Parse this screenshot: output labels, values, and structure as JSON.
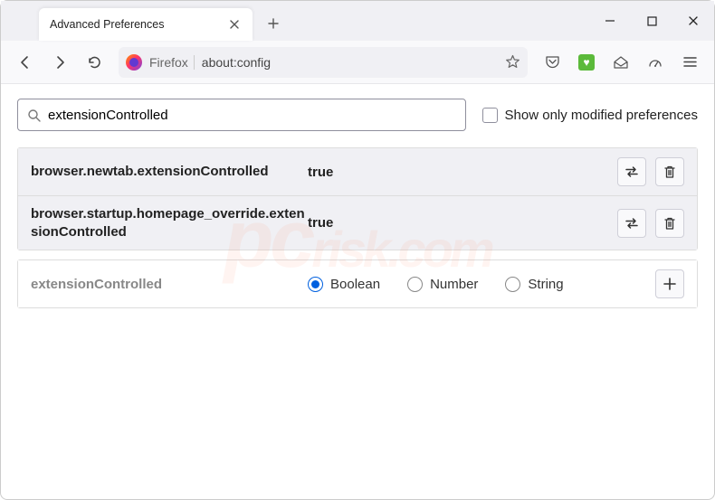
{
  "window": {
    "tab_title": "Advanced Preferences"
  },
  "urlbar": {
    "brand": "Firefox",
    "url": "about:config"
  },
  "search": {
    "value": "extensionControlled",
    "checkbox_label": "Show only modified preferences"
  },
  "prefs": [
    {
      "name": "browser.newtab.extensionControlled",
      "value": "true"
    },
    {
      "name": "browser.startup.homepage_override.extensionControlled",
      "value": "true"
    }
  ],
  "new_pref": {
    "name": "extensionControlled",
    "types": [
      "Boolean",
      "Number",
      "String"
    ],
    "selected": "Boolean"
  },
  "watermark": {
    "big": "pc",
    "rest": "risk.com"
  }
}
